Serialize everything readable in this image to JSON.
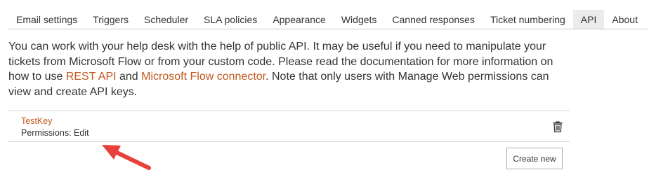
{
  "tabs": [
    {
      "label": "Email settings"
    },
    {
      "label": "Triggers"
    },
    {
      "label": "Scheduler"
    },
    {
      "label": "SLA policies"
    },
    {
      "label": "Appearance"
    },
    {
      "label": "Widgets"
    },
    {
      "label": "Canned responses"
    },
    {
      "label": "Ticket numbering"
    },
    {
      "label": "API",
      "active": true
    },
    {
      "label": "About"
    }
  ],
  "description": {
    "part1": "You can work with your help desk with the help of public API. It may be useful if you need to manipulate your tickets from Microsoft Flow or from your custom code. Please read the documentation for more information on how to use ",
    "link1": "REST API",
    "part2": " and ",
    "link2": "Microsoft Flow connector",
    "part3": ". Note that only users with Manage Web permissions can view and create API keys."
  },
  "api_keys": [
    {
      "name": "TestKey",
      "permissions": "Permissions: Edit",
      "delete_icon": "trash-icon"
    }
  ],
  "create_button_label": "Create new",
  "colors": {
    "link": "#c0581e",
    "active_tab_bg": "#ececec",
    "annotation_arrow": "#e8413c"
  }
}
